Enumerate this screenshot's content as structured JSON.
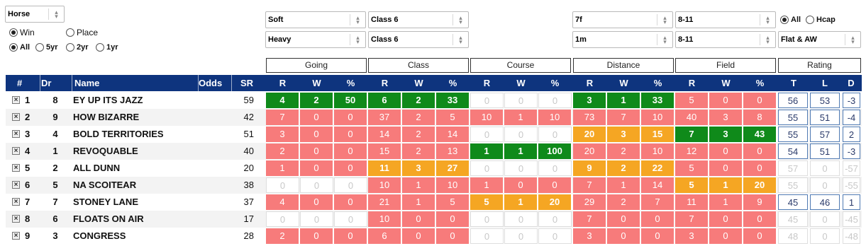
{
  "filters": {
    "type_select": "Horse",
    "result_win": "Win",
    "result_place": "Place",
    "period_all": "All",
    "period_5yr": "5yr",
    "period_2yr": "2yr",
    "period_1yr": "1yr",
    "going_1": "Soft",
    "going_2": "Heavy",
    "class_1": "Class 6",
    "class_2": "Class 6",
    "distance_1": "7f",
    "distance_2": "1m",
    "field_1": "8-11",
    "field_2": "8-11",
    "race_all": "All",
    "race_hcap": "Hcap",
    "surface": "Flat & AW"
  },
  "group_headers": [
    "Going",
    "Class",
    "Course",
    "Distance",
    "Field",
    "Rating"
  ],
  "columns": {
    "num": "#",
    "dr": "Dr",
    "name": "Name",
    "odds": "Odds",
    "sr": "SR",
    "r": "R",
    "w": "W",
    "pct": "%",
    "t": "T",
    "l": "L",
    "d": "D"
  },
  "rows": [
    {
      "num": "1",
      "dr": "8",
      "name": "EY UP ITS JAZZ",
      "sr": "59",
      "groups": [
        [
          "4",
          "2",
          "50"
        ],
        [
          "6",
          "2",
          "33"
        ],
        [
          "0",
          "0",
          "0"
        ],
        [
          "3",
          "1",
          "33"
        ],
        [
          "5",
          "0",
          "0"
        ]
      ],
      "colors": [
        "green",
        "green",
        "empty",
        "green",
        "red"
      ],
      "rating": [
        "56",
        "53",
        "-3"
      ],
      "rating_dim": false
    },
    {
      "num": "2",
      "dr": "9",
      "name": "HOW BIZARRE",
      "sr": "42",
      "groups": [
        [
          "7",
          "0",
          "0"
        ],
        [
          "37",
          "2",
          "5"
        ],
        [
          "10",
          "1",
          "10"
        ],
        [
          "73",
          "7",
          "10"
        ],
        [
          "40",
          "3",
          "8"
        ]
      ],
      "colors": [
        "red",
        "red",
        "red",
        "red",
        "red"
      ],
      "rating": [
        "55",
        "51",
        "-4"
      ],
      "rating_dim": false
    },
    {
      "num": "3",
      "dr": "4",
      "name": "BOLD TERRITORIES",
      "sr": "51",
      "groups": [
        [
          "3",
          "0",
          "0"
        ],
        [
          "14",
          "2",
          "14"
        ],
        [
          "0",
          "0",
          "0"
        ],
        [
          "20",
          "3",
          "15"
        ],
        [
          "7",
          "3",
          "43"
        ]
      ],
      "colors": [
        "red",
        "red",
        "empty",
        "amber",
        "green"
      ],
      "rating": [
        "55",
        "57",
        "2"
      ],
      "rating_dim": false
    },
    {
      "num": "4",
      "dr": "1",
      "name": "REVOQUABLE",
      "sr": "40",
      "groups": [
        [
          "2",
          "0",
          "0"
        ],
        [
          "15",
          "2",
          "13"
        ],
        [
          "1",
          "1",
          "100"
        ],
        [
          "20",
          "2",
          "10"
        ],
        [
          "12",
          "0",
          "0"
        ]
      ],
      "colors": [
        "red",
        "red",
        "green",
        "red",
        "red"
      ],
      "rating": [
        "54",
        "51",
        "-3"
      ],
      "rating_dim": false
    },
    {
      "num": "5",
      "dr": "2",
      "name": "ALL DUNN",
      "sr": "20",
      "groups": [
        [
          "1",
          "0",
          "0"
        ],
        [
          "11",
          "3",
          "27"
        ],
        [
          "0",
          "0",
          "0"
        ],
        [
          "9",
          "2",
          "22"
        ],
        [
          "5",
          "0",
          "0"
        ]
      ],
      "colors": [
        "red",
        "amber",
        "empty",
        "amber",
        "red"
      ],
      "rating": [
        "57",
        "0",
        "-57"
      ],
      "rating_dim": true
    },
    {
      "num": "6",
      "dr": "5",
      "name": "NA SCOITEAR",
      "sr": "38",
      "groups": [
        [
          "0",
          "0",
          "0"
        ],
        [
          "10",
          "1",
          "10"
        ],
        [
          "1",
          "0",
          "0"
        ],
        [
          "7",
          "1",
          "14"
        ],
        [
          "5",
          "1",
          "20"
        ]
      ],
      "colors": [
        "empty",
        "red",
        "red",
        "red",
        "amber"
      ],
      "rating": [
        "55",
        "0",
        "-55"
      ],
      "rating_dim": true
    },
    {
      "num": "7",
      "dr": "7",
      "name": "STONEY LANE",
      "sr": "37",
      "groups": [
        [
          "4",
          "0",
          "0"
        ],
        [
          "21",
          "1",
          "5"
        ],
        [
          "5",
          "1",
          "20"
        ],
        [
          "29",
          "2",
          "7"
        ],
        [
          "11",
          "1",
          "9"
        ]
      ],
      "colors": [
        "red",
        "red",
        "amber",
        "red",
        "red"
      ],
      "rating": [
        "45",
        "46",
        "1"
      ],
      "rating_dim": false
    },
    {
      "num": "8",
      "dr": "6",
      "name": "FLOATS ON AIR",
      "sr": "17",
      "groups": [
        [
          "0",
          "0",
          "0"
        ],
        [
          "10",
          "0",
          "0"
        ],
        [
          "0",
          "0",
          "0"
        ],
        [
          "7",
          "0",
          "0"
        ],
        [
          "7",
          "0",
          "0"
        ]
      ],
      "colors": [
        "empty",
        "red",
        "empty",
        "red",
        "red"
      ],
      "rating": [
        "45",
        "0",
        "-45"
      ],
      "rating_dim": true
    },
    {
      "num": "9",
      "dr": "3",
      "name": "CONGRESS",
      "sr": "28",
      "groups": [
        [
          "2",
          "0",
          "0"
        ],
        [
          "6",
          "0",
          "0"
        ],
        [
          "0",
          "0",
          "0"
        ],
        [
          "3",
          "0",
          "0"
        ],
        [
          "3",
          "0",
          "0"
        ]
      ],
      "colors": [
        "red",
        "red",
        "empty",
        "red",
        "red"
      ],
      "rating": [
        "48",
        "0",
        "-48"
      ],
      "rating_dim": true
    }
  ]
}
